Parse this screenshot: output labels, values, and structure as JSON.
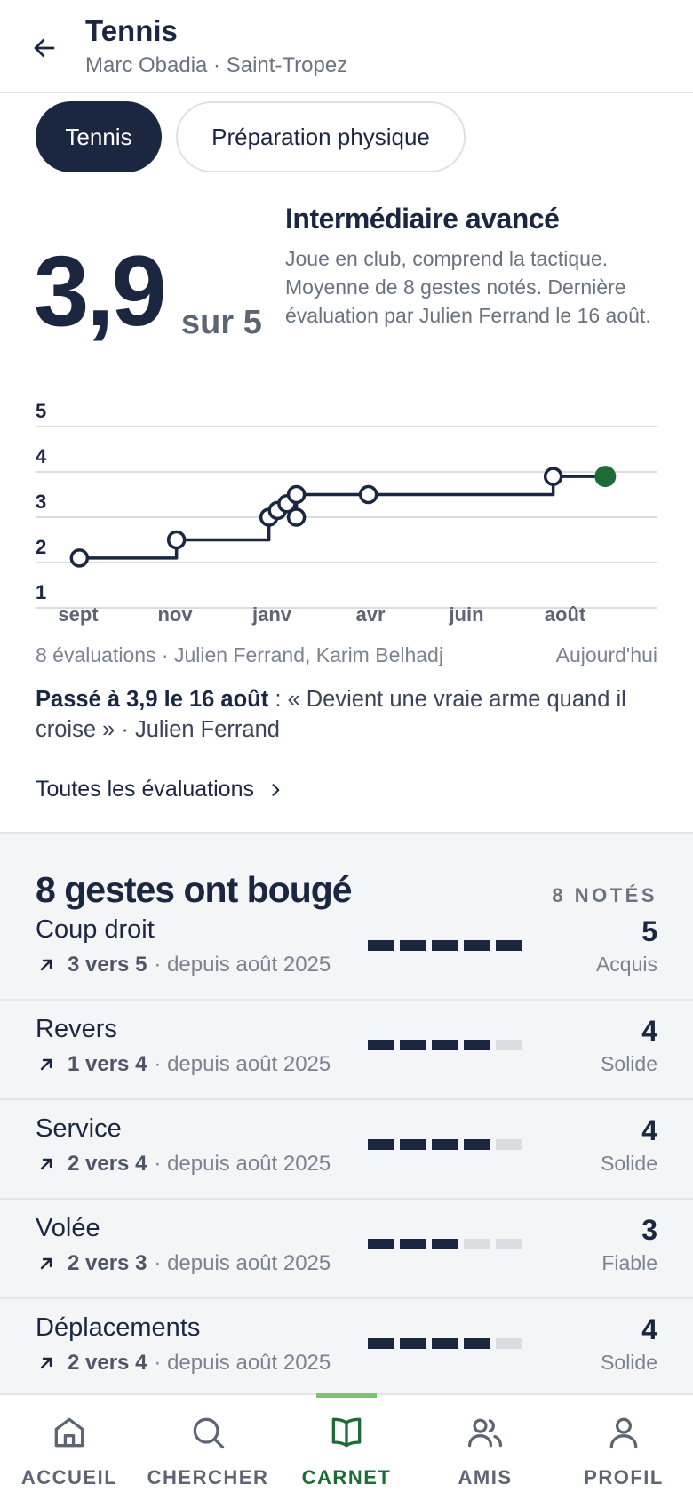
{
  "header": {
    "title": "Tennis",
    "subtitle": "Marc Obadia · Saint-Tropez"
  },
  "tabs": [
    {
      "label": "Tennis",
      "active": true
    },
    {
      "label": "Préparation physique",
      "active": false
    }
  ],
  "score": {
    "value": "3,9",
    "suffix": "sur 5",
    "level": "Intermédiaire avancé",
    "description": "Joue en club, comprend la tactique. Moyenne de 8 gestes notés. Dernière évaluation par Julien Ferrand le 16 août."
  },
  "chart_data": {
    "type": "line",
    "y_ticks": [
      "5",
      "4",
      "3",
      "2",
      "1"
    ],
    "x_ticks": [
      "sept",
      "nov",
      "janv",
      "avr",
      "juin",
      "août"
    ],
    "ylim": [
      1,
      5
    ],
    "xlim": [
      0,
      12
    ],
    "step": true,
    "points": [
      {
        "x": 0.4,
        "y": 2.1
      },
      {
        "x": 2.45,
        "y": 2.5
      },
      {
        "x": 4.4,
        "y": 3.0
      },
      {
        "x": 4.58,
        "y": 3.15
      },
      {
        "x": 4.78,
        "y": 3.3
      },
      {
        "x": 4.98,
        "y": 3.0
      },
      {
        "x": 4.98,
        "y": 3.5
      },
      {
        "x": 6.5,
        "y": 3.5
      },
      {
        "x": 10.4,
        "y": 3.9
      }
    ],
    "current": {
      "x": 11.5,
      "y": 3.9
    },
    "colors": {
      "line": "#1b2740",
      "current": "#1e6b38",
      "grid": "#d9dce0"
    }
  },
  "chart_meta": {
    "left": "8 évaluations · Julien Ferrand, Karim Belhadj",
    "right": "Aujourd'hui"
  },
  "quote": {
    "bold": "Passé à 3,9 le 16 août",
    "text": " : « Devient une vraie arme quand il croise » · Julien Ferrand"
  },
  "all_evals_label": "Toutes les évaluations",
  "gestures": {
    "title": "8 gestes ont bougé",
    "count": "8 NOTÉS",
    "items": [
      {
        "name": "Coup droit",
        "trend": "3 vers 5",
        "since": "· depuis août 2025",
        "score": "5",
        "label": "Acquis",
        "level": 5
      },
      {
        "name": "Revers",
        "trend": "1 vers 4",
        "since": "· depuis août 2025",
        "score": "4",
        "label": "Solide",
        "level": 4
      },
      {
        "name": "Service",
        "trend": "2 vers 4",
        "since": "· depuis août 2025",
        "score": "4",
        "label": "Solide",
        "level": 4
      },
      {
        "name": "Volée",
        "trend": "2 vers 3",
        "since": "· depuis août 2025",
        "score": "3",
        "label": "Fiable",
        "level": 3
      },
      {
        "name": "Déplacements",
        "trend": "2 vers 4",
        "since": "· depuis août 2025",
        "score": "4",
        "label": "Solide",
        "level": 4
      }
    ]
  },
  "nav": {
    "items": [
      {
        "label": "ACCUEIL",
        "icon": "home-icon"
      },
      {
        "label": "CHERCHER",
        "icon": "search-icon"
      },
      {
        "label": "CARNET",
        "icon": "book-icon",
        "active": true
      },
      {
        "label": "AMIS",
        "icon": "users-icon"
      },
      {
        "label": "PROFIL",
        "icon": "user-icon"
      }
    ]
  }
}
